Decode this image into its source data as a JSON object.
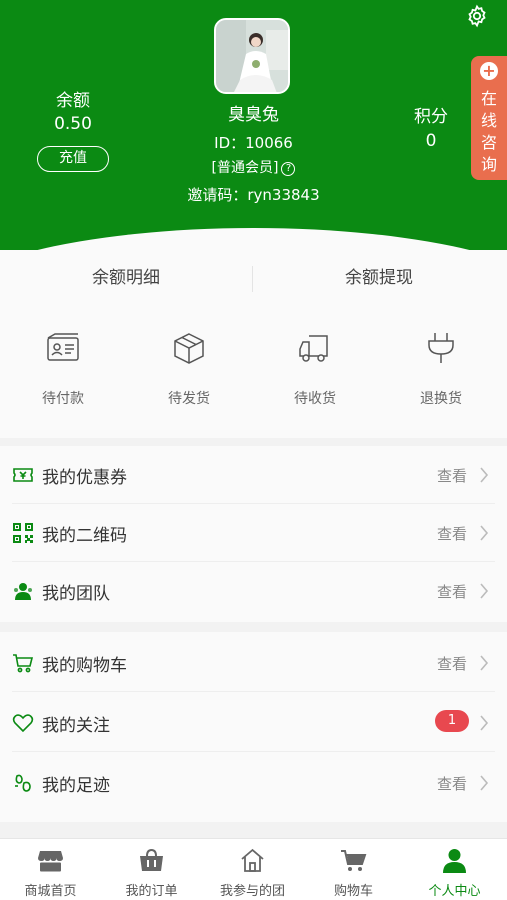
{
  "profile": {
    "username": "臭臭兔",
    "user_id": "ID：10066",
    "member_level": "[普通会员]",
    "help_mark": "?",
    "invite_code": "邀请码：ryn33843",
    "balance_label": "余额",
    "balance_value": "0.50",
    "recharge_label": "充值",
    "points_label": "积分",
    "points_value": "0",
    "consult_label": "在线咨询",
    "consult_icon": "plus-icon",
    "settings_icon": "gear-icon"
  },
  "balance_links": {
    "detail": "余额明细",
    "withdraw": "余额提现"
  },
  "orders": [
    {
      "label": "待付款",
      "icon": "id-card-icon"
    },
    {
      "label": "待发货",
      "icon": "box-icon"
    },
    {
      "label": "待收货",
      "icon": "truck-icon"
    },
    {
      "label": "退换货",
      "icon": "plug-icon"
    }
  ],
  "menu": [
    {
      "label": "我的优惠券",
      "action": "查看",
      "icon": "coupon-icon"
    },
    {
      "label": "我的二维码",
      "action": "查看",
      "icon": "qrcode-icon"
    },
    {
      "label": "我的团队",
      "action": "查看",
      "icon": "team-icon"
    },
    {
      "label": "我的购物车",
      "action": "查看",
      "icon": "cart-icon"
    },
    {
      "label": "我的关注",
      "badge": "1",
      "icon": "heart-icon"
    },
    {
      "label": "我的足迹",
      "action": "查看",
      "icon": "footprint-icon"
    }
  ],
  "tabs": [
    {
      "label": "商城首页",
      "icon": "store-icon"
    },
    {
      "label": "我的订单",
      "icon": "basket-icon"
    },
    {
      "label": "我参与的团",
      "icon": "home-icon"
    },
    {
      "label": "购物车",
      "icon": "cart-icon"
    },
    {
      "label": "个人中心",
      "icon": "person-icon",
      "active": true
    }
  ],
  "colors": {
    "brand_green": "#0b8a13",
    "consult_orange": "#e96e4e",
    "badge_red": "#e8484f"
  }
}
